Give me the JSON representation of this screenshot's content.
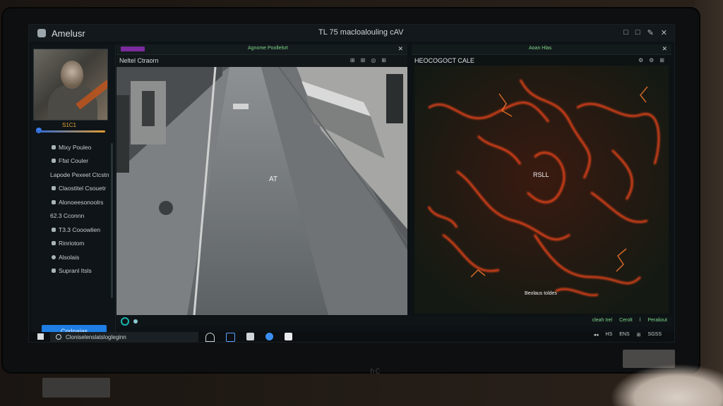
{
  "app": {
    "name": "Amelusr",
    "window_title": "TL 75 macloalouling cAV"
  },
  "window_controls": [
    "□",
    "□",
    "✎",
    "✕"
  ],
  "sidebar": {
    "avatar_caption": "S1C1",
    "nav_items": [
      {
        "label": "Mixy Pouleo",
        "icon": "user-icon"
      },
      {
        "label": "Ffat Couler",
        "icon": "flag-icon"
      },
      {
        "label": "Lapode Pexeet Ctcstn",
        "icon": "none"
      },
      {
        "label": "Claostitel Csouetr",
        "icon": "list-icon"
      },
      {
        "label": "Alonoeesonoolrs",
        "icon": "list-icon"
      },
      {
        "label": "62.3 Cconnn",
        "icon": "none"
      },
      {
        "label": "T3.3 Cooowlien",
        "icon": "grid-icon"
      },
      {
        "label": "Rinriotom",
        "icon": "square-icon"
      },
      {
        "label": "Alsolais",
        "icon": "circle-icon"
      },
      {
        "label": "Supranl Itsls",
        "icon": "gear-icon"
      }
    ],
    "primary_button": "Corloaias"
  },
  "left_panel": {
    "tab_label": "",
    "header_label": "Agnome Poollelsrt",
    "subtitle": "Neltel Ctraorn",
    "tools": [
      "⊞",
      "⊞",
      "◎",
      "⊞"
    ],
    "close": "✕",
    "overlay_label": "AT"
  },
  "right_panel": {
    "header_label": "Aoan Hlas",
    "close": "✕",
    "title": "HEOCOGOCT CALE",
    "tools": [
      "⚙",
      "⚙",
      "⊞"
    ],
    "center_label": "RSLL",
    "caption": "Beolaus toldes"
  },
  "status": {
    "right_labels": [
      "cleah trel",
      "Cerolt",
      "l",
      "Peraliout"
    ]
  },
  "tray": [
    "◂◂",
    "HS",
    "ENS",
    "⊞",
    "SGSS"
  ],
  "taskbar": {
    "search_text": "Cloniselenslatslogleginn"
  },
  "colors": {
    "accent_blue": "#1f7ee3",
    "accent_green": "#7fd68a",
    "heat_hot": "#ff4a1a",
    "panel_bg": "#0e1417"
  }
}
